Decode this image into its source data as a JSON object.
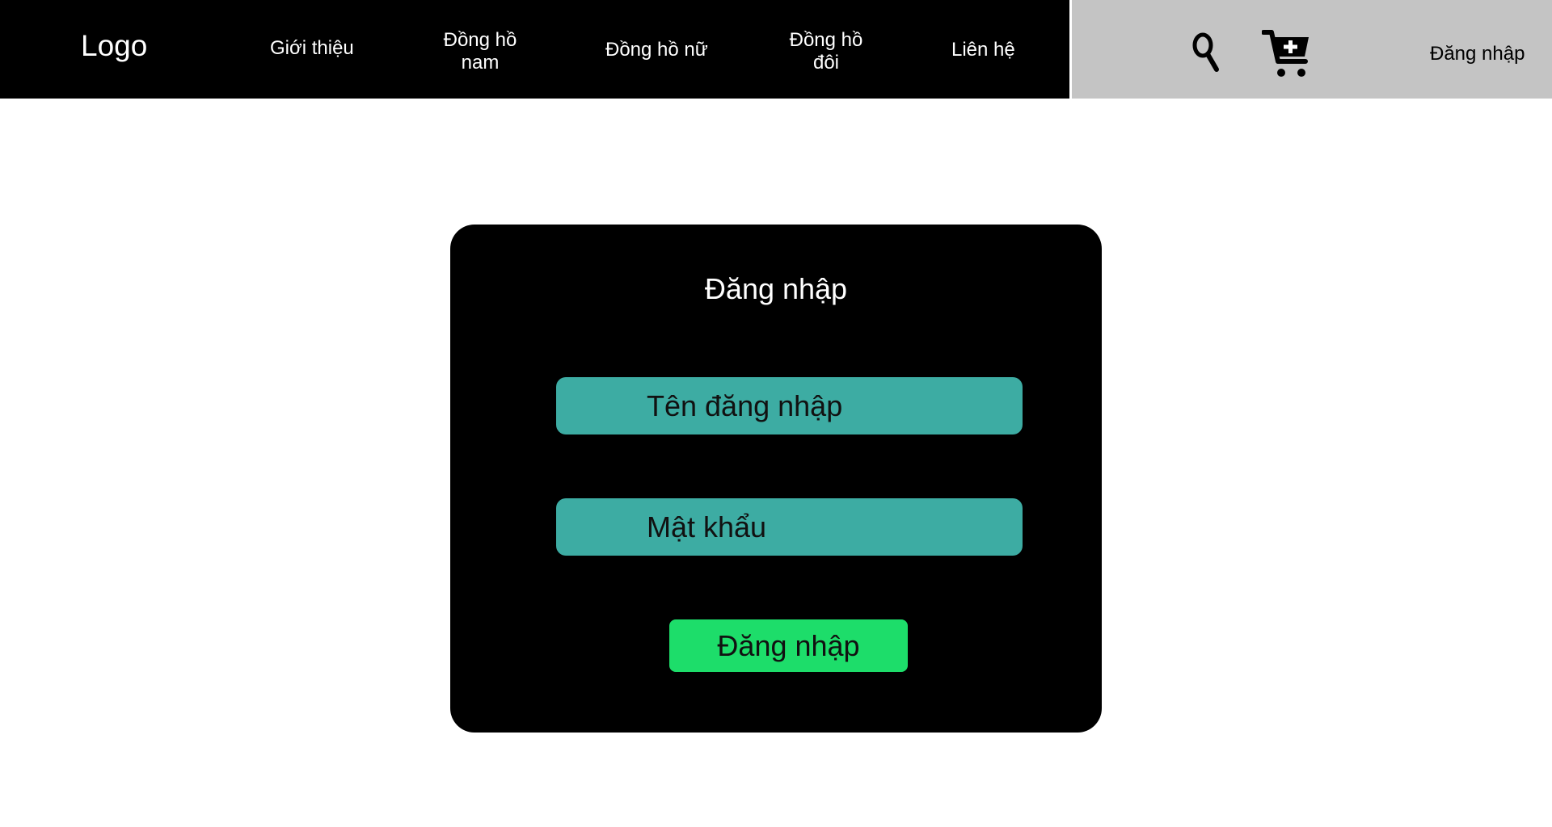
{
  "header": {
    "logo": "Logo",
    "nav": [
      {
        "label": "Giới thiệu"
      },
      {
        "label": "Đồng hồ nam",
        "line1": "Đồng hồ",
        "line2": "nam"
      },
      {
        "label": "Đồng hồ nữ"
      },
      {
        "label": "Đồng hồ đôi",
        "line1": "Đồng hồ",
        "line2": "đôi"
      },
      {
        "label": "Liên hệ"
      }
    ],
    "search_icon": "search-icon",
    "cart_icon": "cart-add-icon",
    "login_link": "Đăng nhập"
  },
  "login_form": {
    "title": "Đăng nhập",
    "username_placeholder": "Tên đăng nhập",
    "password_placeholder": "Mật khẩu",
    "submit_label": "Đăng nhập"
  },
  "colors": {
    "header_bg": "#000000",
    "header_right_bg": "#c4c4c4",
    "field_bg": "#3daca3",
    "submit_bg": "#1ddd6a"
  }
}
